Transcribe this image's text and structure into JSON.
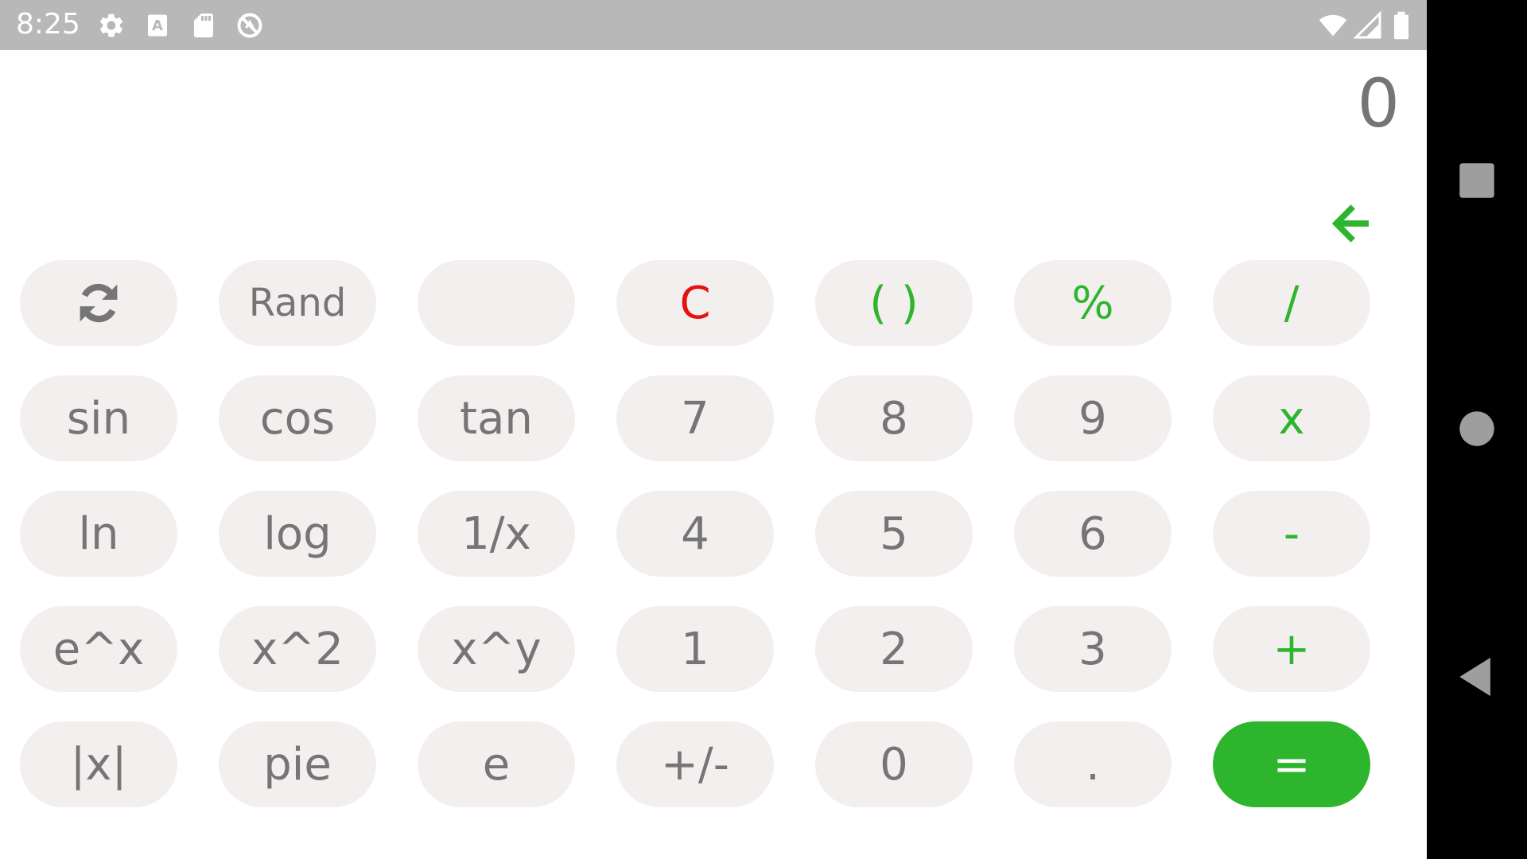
{
  "status_bar": {
    "time": "8:25",
    "icons_left": [
      "gear-icon",
      "keyboard-a-icon",
      "sd-card-icon",
      "do-not-disturb-icon"
    ],
    "icons_right": [
      "wifi-icon",
      "signal-icon",
      "battery-icon"
    ]
  },
  "display": {
    "value": "0",
    "backspace_icon": "arrow-left-icon",
    "accent_color": "#2db52d"
  },
  "keypad": {
    "row1": {
      "refresh_icon": "refresh-icon",
      "rand": "Rand",
      "blank": "",
      "clear": "C",
      "parens": "( )",
      "percent": "%",
      "divide": "/"
    },
    "row2": {
      "sin": "sin",
      "cos": "cos",
      "tan": "tan",
      "seven": "7",
      "eight": "8",
      "nine": "9",
      "multiply": "x"
    },
    "row3": {
      "ln": "ln",
      "log": "log",
      "reciprocal": "1/x",
      "four": "4",
      "five": "5",
      "six": "6",
      "minus": "-"
    },
    "row4": {
      "exp": "e^x",
      "square": "x^2",
      "power": "x^y",
      "one": "1",
      "two": "2",
      "three": "3",
      "plus": "+"
    },
    "row5": {
      "abs": "|x|",
      "pie": "pie",
      "e": "e",
      "negate": "+/-",
      "zero": "0",
      "dot": ".",
      "equals": "="
    }
  },
  "colors": {
    "key_background": "#f2efee",
    "key_text": "#757575",
    "operator": "#2db52d",
    "clear": "#e51212",
    "status_bar": "#b8b8b8"
  },
  "nav_bar": {
    "buttons": [
      "recents-square-icon",
      "home-circle-icon",
      "back-triangle-icon"
    ]
  }
}
